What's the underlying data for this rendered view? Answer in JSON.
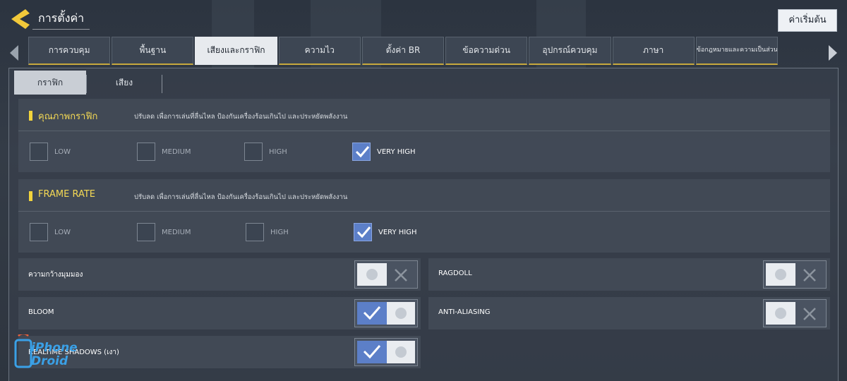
{
  "header": {
    "title": "การตั้งค่า",
    "reset_label": "ค่าเริ่มต้น"
  },
  "tabs": [
    {
      "label": "การควบคุม"
    },
    {
      "label": "พื้นฐาน"
    },
    {
      "label": "เสียงและกราฟิก"
    },
    {
      "label": "ความไว"
    },
    {
      "label": "ตั้งค่า BR"
    },
    {
      "label": "ข้อความด่วน"
    },
    {
      "label": "อุปกรณ์ควบคุม"
    },
    {
      "label": "ภาษา"
    },
    {
      "label": "ข้อกฎหมายและความเป็นส่วนตัว"
    }
  ],
  "subtabs": [
    {
      "label": "กราฟิก"
    },
    {
      "label": "เสียง"
    }
  ],
  "graphics_quality": {
    "title": "คุณภาพกราฟิก",
    "description": "ปรับลด เพื่อการเล่นที่ลื่นไหล ป้องกันเครื่องร้อนเกินไป และประหยัดพลังงาน",
    "options": [
      "LOW",
      "MEDIUM",
      "HIGH",
      "VERY HIGH"
    ],
    "selected": "VERY HIGH"
  },
  "frame_rate": {
    "title": "FRAME RATE",
    "description": "ปรับลด เพื่อการเล่นที่ลื่นไหล ป้องกันเครื่องร้อนเกินไป และประหยัดพลังงาน",
    "options": [
      "LOW",
      "MEDIUM",
      "HIGH",
      "VERY HIGH"
    ],
    "selected": "VERY HIGH"
  },
  "toggles": [
    {
      "label": "ความกว้างมุมมอง",
      "enabled": false
    },
    {
      "label": "RAGDOLL",
      "enabled": false
    },
    {
      "label": "BLOOM",
      "enabled": true
    },
    {
      "label": "ANTI-ALIASING",
      "enabled": false
    },
    {
      "label": "REALTIME SHADOWS (เงา)",
      "enabled": true
    }
  ],
  "watermark": {
    "line1": "iPhone",
    "line2": "Droid"
  },
  "colors": {
    "accent_yellow": "#f2d43c",
    "selected_blue": "#5c7fc8",
    "active_tab": "#e7eaee"
  }
}
